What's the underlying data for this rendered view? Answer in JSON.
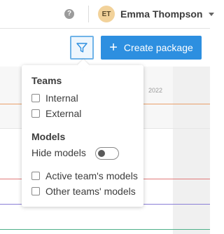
{
  "header": {
    "help_icon": "question-circle-icon",
    "help_glyph": "?",
    "user": {
      "initials": "ET",
      "name": "Emma Thompson",
      "avatar_color": "#f2d29a"
    }
  },
  "toolbar": {
    "filter_icon": "filter-funnel-icon",
    "create_button": {
      "plus": "+",
      "label": "Create package",
      "color": "#2d8fe0"
    }
  },
  "timeline": {
    "year_label": "2022",
    "line_colors": [
      "#e8a06a",
      "#e07a7a",
      "#8b7fd6",
      "#4fb08a"
    ]
  },
  "filter_menu": {
    "teams": {
      "title": "Teams",
      "options": [
        {
          "label": "Internal",
          "checked": false
        },
        {
          "label": "External",
          "checked": false
        }
      ]
    },
    "models": {
      "title": "Models",
      "hide_models": {
        "label": "Hide models",
        "on": false
      },
      "options": [
        {
          "label": "Active team's models",
          "checked": false
        },
        {
          "label": "Other teams' models",
          "checked": false
        }
      ]
    }
  }
}
